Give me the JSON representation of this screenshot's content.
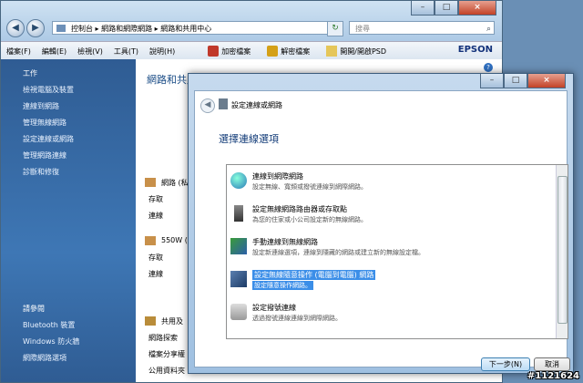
{
  "back_window": {
    "address": {
      "root": "控制台",
      "sep1": "▸",
      "part2": "網路和網際網路",
      "sep2": "▸",
      "part3": "網路和共用中心"
    },
    "search_placeholder": "搜尋",
    "menu": [
      "檔案(F)",
      "編輯(E)",
      "檢視(V)",
      "工具(T)",
      "說明(H)"
    ],
    "tools": [
      {
        "label": "加密檔案",
        "icon": "lock-icon"
      },
      {
        "label": "解密檔案",
        "icon": "unlock-icon"
      },
      {
        "label": "開開/開啟PSD",
        "icon": "folder-icon"
      }
    ],
    "brand": "EPSON",
    "sidebar": {
      "tasks_header": "工作",
      "tasks": [
        "檢視電腦及裝置",
        "連線到網路",
        "管理無線網路",
        "設定連線或網路",
        "管理網路連線",
        "診斷和修復"
      ],
      "see_also_header": "請參閱",
      "see_also": [
        "Bluetooth 裝置",
        "Windows 防火牆",
        "網際網路選項"
      ]
    },
    "content": {
      "title": "網路和共用中心",
      "network1": {
        "name": "網路 (私",
        "access_label": "存取",
        "conn_label": "連線"
      },
      "network2": {
        "name": "550W (",
        "access_label": "存取",
        "conn_label": "連線"
      },
      "sharing_header": "共用及",
      "sharing_rows": [
        "網路探索",
        "檔案分享權",
        "公用資料夾"
      ]
    }
  },
  "dialog": {
    "title": "設定連線或網路",
    "heading": "選擇連線選項",
    "options": [
      {
        "title": "連線到網際網路",
        "desc": "設定無線、寬頻或撥號連線到網際網路。",
        "icon": "globe-icon"
      },
      {
        "title": "設定無線網路路由器或存取點",
        "desc": "為您的住家或小公司設定新的無線網路。",
        "icon": "router-icon"
      },
      {
        "title": "手動連線到無線網路",
        "desc": "設定新連線選項，連線到隱藏的網路或建立新的無線設定檔。",
        "icon": "wireless-icon"
      },
      {
        "title": "設定無線隨意操作 (電腦到電腦) 網路",
        "desc": "設定隨意操作網路。",
        "icon": "adhoc-icon",
        "selected": true
      },
      {
        "title": "設定撥號連線",
        "desc": "透過撥號連線連線到網際網路。",
        "icon": "dialup-icon"
      }
    ],
    "next_button": "下一步(N)",
    "cancel_button": "取消"
  },
  "watermark": "#1121624"
}
